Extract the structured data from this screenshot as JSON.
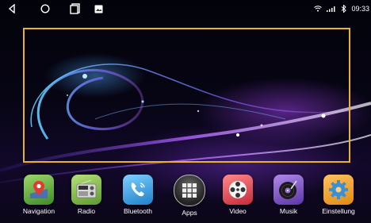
{
  "status_bar": {
    "nav": [
      "back-icon",
      "home-icon",
      "recents-icon",
      "screenshot-icon"
    ],
    "icons": [
      "wifi-icon",
      "signal-icon",
      "bluetooth-icon"
    ],
    "time": "09:33"
  },
  "colors": {
    "highlight_border": "#e8b327"
  },
  "dock": {
    "apps": [
      {
        "label": "Navigation",
        "icon": "map-pin-icon",
        "color": "#5aa83a"
      },
      {
        "label": "Radio",
        "icon": "radio-icon",
        "color": "#8bbf3c"
      },
      {
        "label": "Bluetooth",
        "icon": "phone-icon",
        "color": "#3aa8e0"
      },
      {
        "label": "Apps",
        "icon": "apps-grid-icon",
        "color": "#444444"
      },
      {
        "label": "Video",
        "icon": "film-reel-icon",
        "color": "#e04a5a"
      },
      {
        "label": "Musik",
        "icon": "vinyl-record-icon",
        "color": "#7a4fc0"
      },
      {
        "label": "Einstellung",
        "icon": "gear-icon",
        "color": "#f0a020"
      }
    ]
  }
}
